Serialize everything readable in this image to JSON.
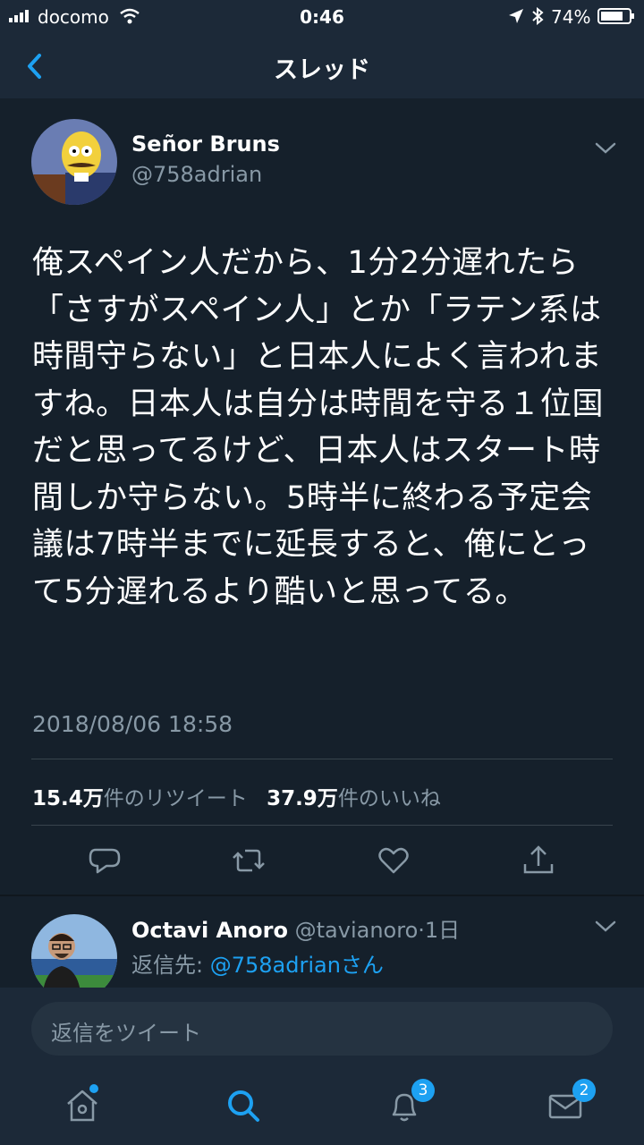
{
  "status": {
    "carrier": "docomo",
    "time": "0:46",
    "battery": "74%"
  },
  "header": {
    "title": "スレッド"
  },
  "tweet": {
    "name": "Señor Bruns",
    "handle": "@758adrian",
    "body": "俺スペイン人だから、1分2分遅れたら「さすがスペイン人」とか「ラテン系は時間守らない」と日本人によく言われますね。日本人は自分は時間を守る１位国だと思ってるけど、日本人はスタート時間しか守らない。5時半に終わる予定会議は7時半までに延長すると、俺にとって5分遅れるより酷いと思ってる。",
    "timestamp": "2018/08/06 18:58",
    "retweet_count": "15.4万",
    "retweet_label": "件のリツイート",
    "like_count": "37.9万",
    "like_label": "件のいいね"
  },
  "reply": {
    "name": "Octavi Anoro",
    "handle": "@tavianoro",
    "time": "1日",
    "reply_prefix": "返信先: ",
    "reply_to": "@758adrianさん"
  },
  "compose": {
    "placeholder": "返信をツイート"
  },
  "tabs": {
    "notifications_badge": "3",
    "messages_badge": "2"
  },
  "colors": {
    "accent": "#1da1f2",
    "background": "#15202b",
    "secondary_text": "#8899a6"
  }
}
